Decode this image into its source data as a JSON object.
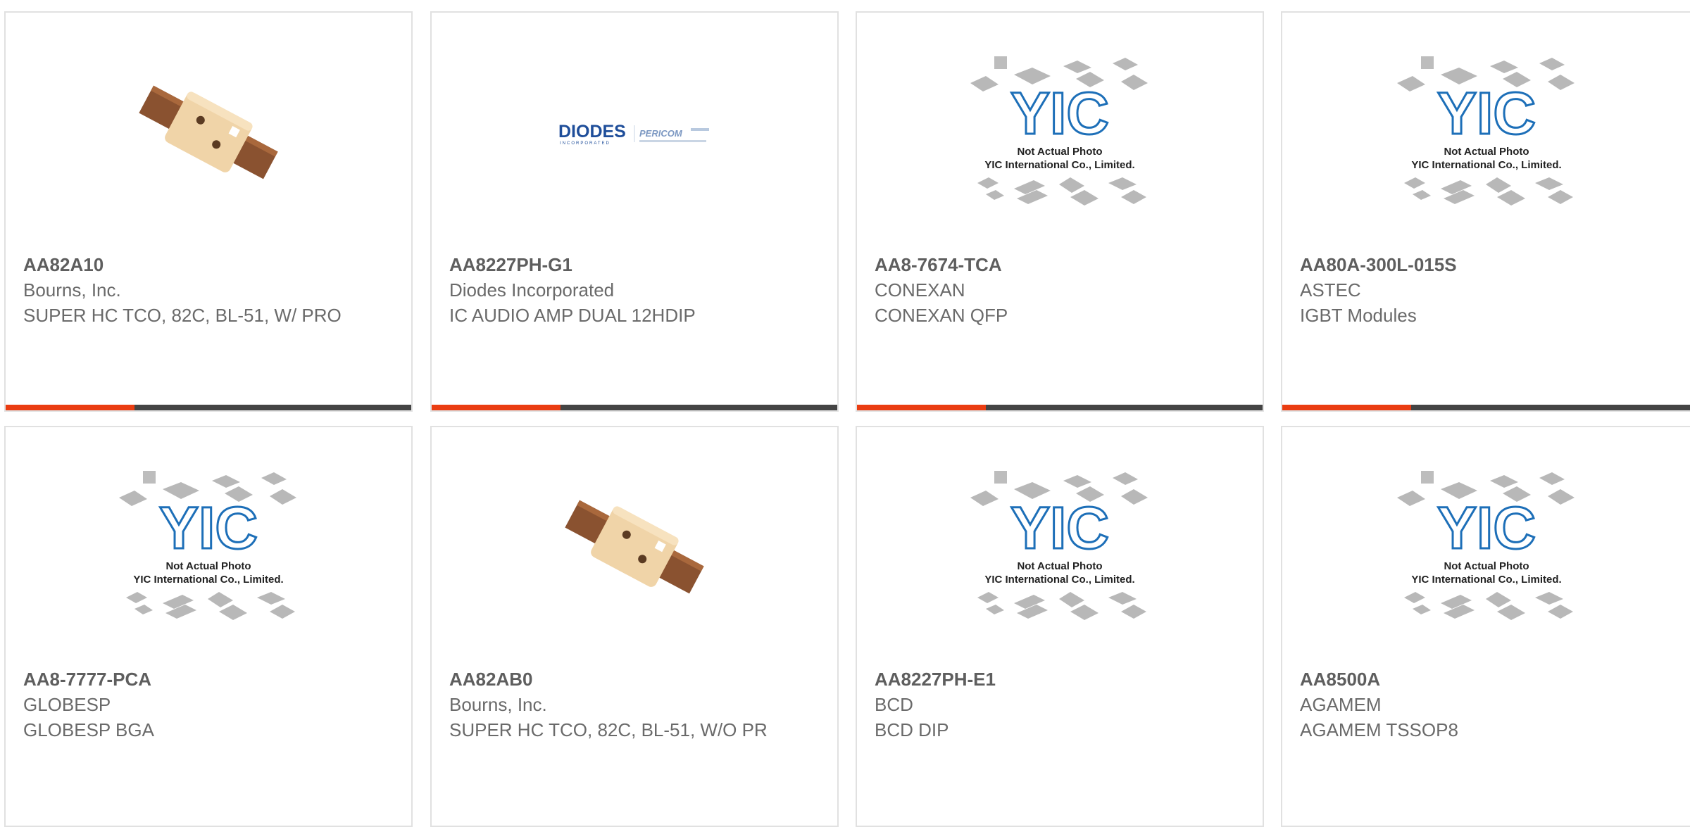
{
  "products": [
    {
      "part": "AA82A10",
      "brand": "Bourns, Inc.",
      "description": "SUPER HC TCO, 82C, BL-51, W/ PRO",
      "image": "thermal-cutoff-photo"
    },
    {
      "part": "AA8227PH-G1",
      "brand": "Diodes Incorporated",
      "description": "IC AUDIO AMP DUAL 12HDIP",
      "image": "diodes-pericom-logo"
    },
    {
      "part": "AA8-7674-TCA",
      "brand": "CONEXAN",
      "description": "CONEXAN QFP",
      "image": "placeholder"
    },
    {
      "part": "AA80A-300L-015S",
      "brand": "ASTEC",
      "description": "IGBT Modules",
      "image": "placeholder"
    },
    {
      "part": "AA8-7777-PCA",
      "brand": "GLOBESP",
      "description": "GLOBESP BGA",
      "image": "placeholder"
    },
    {
      "part": "AA82AB0",
      "brand": "Bourns, Inc.",
      "description": "SUPER HC TCO, 82C, BL-51, W/O PR",
      "image": "thermal-cutoff-photo"
    },
    {
      "part": "AA8227PH-E1",
      "brand": "BCD",
      "description": "BCD DIP",
      "image": "placeholder"
    },
    {
      "part": "AA8500A",
      "brand": "AGAMEM",
      "description": "AGAMEM TSSOP8",
      "image": "placeholder"
    }
  ],
  "placeholder": {
    "logo_text": "YIC",
    "line1": "Not Actual Photo",
    "line2": "YIC International Co., Limited."
  },
  "logos": {
    "diodes": "DIODES",
    "diodes_sub": "INCORPORATED",
    "pericom": "PERICOM"
  },
  "colors": {
    "accent": "#ea3d12",
    "bar": "#444444",
    "border": "#e1e1e1",
    "yic_blue": "#1d6fb8"
  }
}
